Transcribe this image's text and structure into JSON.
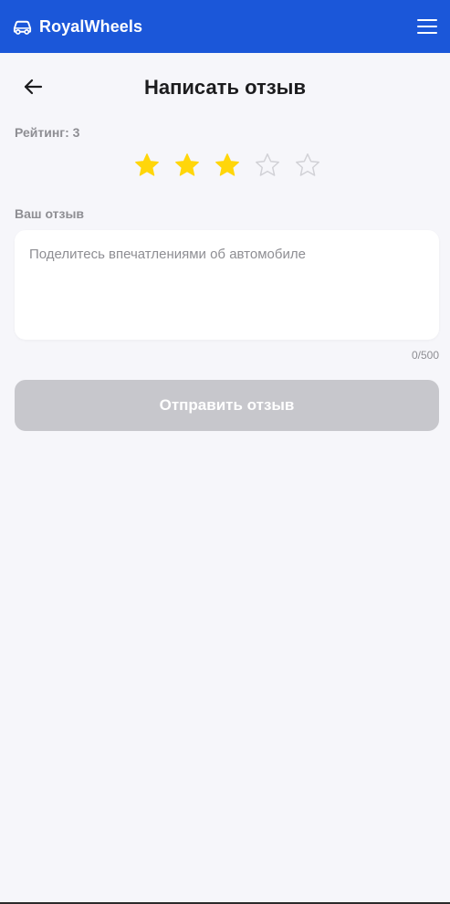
{
  "app": {
    "name": "RoyalWheels",
    "brand_icon": "car-icon",
    "menu_icon": "hamburger-menu-icon"
  },
  "colors": {
    "brand_blue": "#1b57d9",
    "background": "#f6f6fa",
    "star_filled": "#ffd60a",
    "star_empty": "#d1d1d6",
    "label_gray": "#8e8e93",
    "button_disabled": "#c7c7cc"
  },
  "page": {
    "title": "Написать отзыв",
    "back_icon": "arrow-left-icon"
  },
  "rating": {
    "label": "Рейтинг: 3",
    "value": 3,
    "max": 5
  },
  "review": {
    "label": "Ваш отзыв",
    "value": "",
    "placeholder": "Поделитесь впечатлениями об автомобиле",
    "counter": "0/500"
  },
  "submit": {
    "label": "Отправить отзыв",
    "disabled": true
  }
}
